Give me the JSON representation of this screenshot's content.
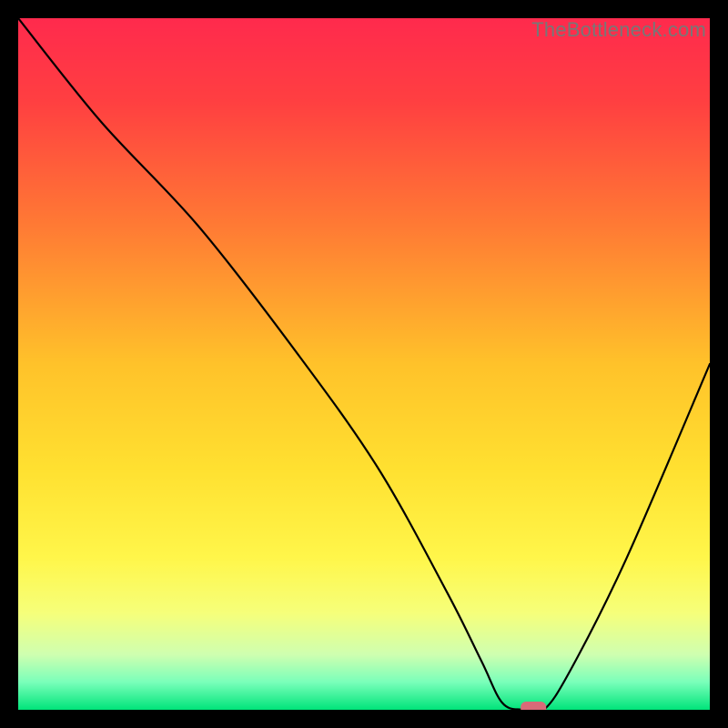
{
  "watermark": "TheBottleneck.com",
  "chart_data": {
    "type": "line",
    "title": "",
    "xlabel": "",
    "ylabel": "",
    "xlim": [
      0,
      100
    ],
    "ylim": [
      0,
      100
    ],
    "grid": false,
    "series": [
      {
        "name": "curve",
        "x": [
          0,
          12,
          26,
          40,
          52,
          62,
          67,
          70,
          73,
          76,
          80,
          88,
          100
        ],
        "values": [
          100,
          85,
          70,
          52,
          35,
          17,
          7,
          1,
          0,
          0,
          6,
          22,
          50
        ]
      }
    ],
    "marker": {
      "x": 74.5,
      "y": 0,
      "color": "#d96a78"
    },
    "gradient_stops": [
      {
        "offset": 0.0,
        "color": "#ff2a4d"
      },
      {
        "offset": 0.12,
        "color": "#ff3f41"
      },
      {
        "offset": 0.3,
        "color": "#ff7a34"
      },
      {
        "offset": 0.5,
        "color": "#ffc22a"
      },
      {
        "offset": 0.65,
        "color": "#ffe030"
      },
      {
        "offset": 0.78,
        "color": "#fff64a"
      },
      {
        "offset": 0.86,
        "color": "#f6ff7a"
      },
      {
        "offset": 0.92,
        "color": "#cfffb0"
      },
      {
        "offset": 0.96,
        "color": "#7affba"
      },
      {
        "offset": 1.0,
        "color": "#00e47a"
      }
    ]
  }
}
